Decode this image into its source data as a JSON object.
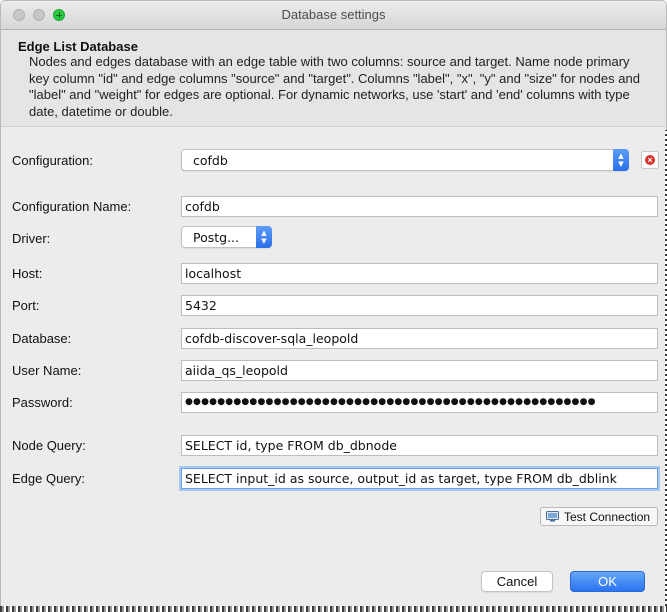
{
  "window": {
    "title": "Database settings"
  },
  "header": {
    "title": "Edge List Database",
    "description": "Nodes and edges database with an edge table with two columns: source and target. Name node primary key column \"id\" and edge columns \"source\" and \"target\". Columns \"label\", \"x\", \"y\" and \"size\" for nodes and \"label\" and \"weight\" for edges are optional. For dynamic networks, use 'start' and 'end' columns with type date, datetime or double."
  },
  "form": {
    "configuration": {
      "label": "Configuration:",
      "value": "cofdb"
    },
    "configuration_name": {
      "label": "Configuration Name:",
      "value": "cofdb"
    },
    "driver": {
      "label": "Driver:",
      "value": "Postg..."
    },
    "host": {
      "label": "Host:",
      "value": "localhost"
    },
    "port": {
      "label": "Port:",
      "value": "5432"
    },
    "database": {
      "label": "Database:",
      "value": "cofdb-discover-sqla_leopold"
    },
    "user_name": {
      "label": "User Name:",
      "value": "aiida_qs_leopold"
    },
    "password": {
      "label": "Password:",
      "value": "●●●●●●●●●●●●●●●●●●●●●●●●●●●●●●●●●●●●●●●●●●●●●●●●●●●"
    },
    "node_query": {
      "label": "Node Query:",
      "value": "SELECT id, type FROM db_dbnode"
    },
    "edge_query": {
      "label": "Edge Query:",
      "value": "SELECT input_id as source, output_id as target, type FROM db_dblink"
    }
  },
  "buttons": {
    "test_connection": "Test Connection",
    "cancel": "Cancel",
    "ok": "OK"
  },
  "icons": {
    "close": "close-icon",
    "minimize": "minimize-icon",
    "zoom": "zoom-icon",
    "delete": "delete-icon",
    "dropdown": "chevron-updown-icon",
    "test_connection": "monitor-icon"
  },
  "colors": {
    "accent": "#2b73f0",
    "delete": "#d8332a"
  }
}
